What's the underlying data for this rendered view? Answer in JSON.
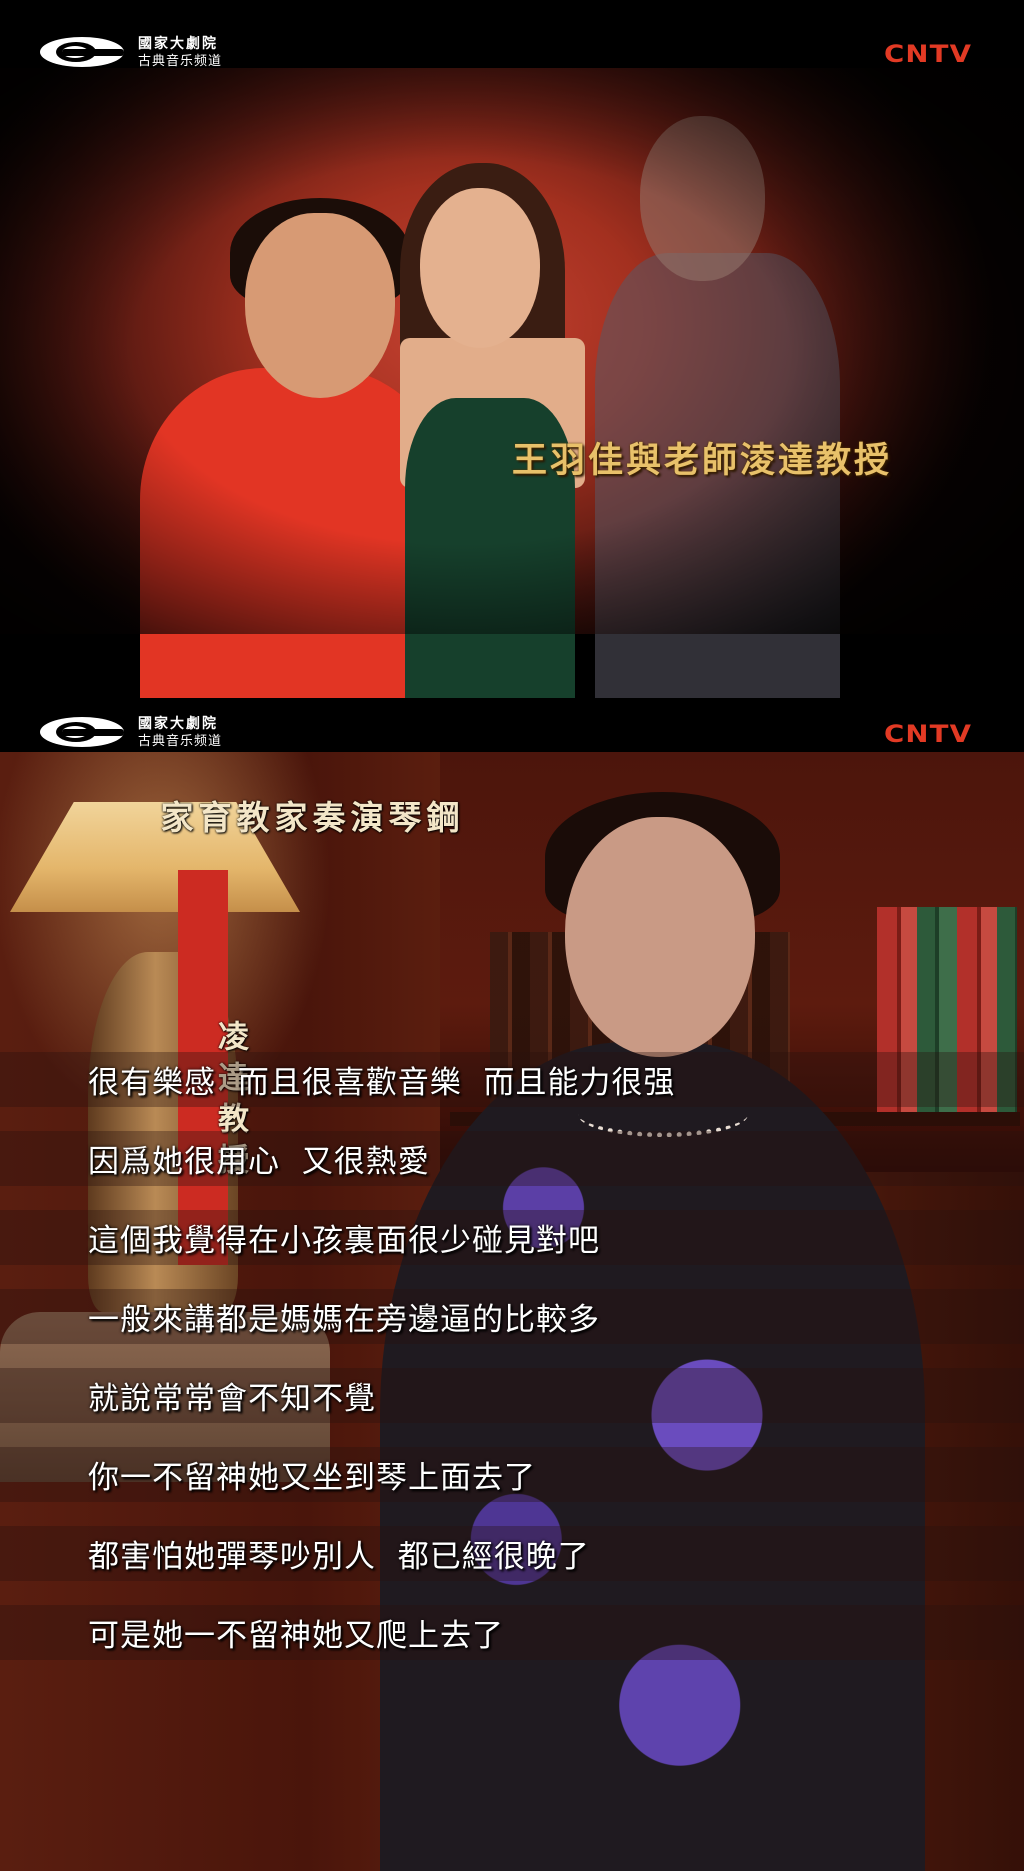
{
  "top_frame": {
    "logo": {
      "line1": "國家大劇院",
      "line2": "古典音乐频道"
    },
    "channel": "CNTV",
    "caption": "王羽佳與老師淩達教授"
  },
  "bottom_frame": {
    "logo": {
      "line1": "國家大劇院",
      "line2": "古典音乐频道"
    },
    "channel": "CNTV",
    "speaker_title": {
      "role": [
        "鋼",
        "琴",
        "演",
        "奏",
        "家",
        "教",
        "育",
        "家"
      ],
      "name": "凌達教授"
    },
    "subtitles": [
      "很有樂感  而且很喜歡音樂  而且能力很强",
      "因爲她很用心  又很熱愛",
      "這個我覺得在小孩裏面很少碰見對吧",
      "一般來講都是媽媽在旁邊逼的比較多",
      "就說常常會不知不覺",
      "你一不留神她又坐到琴上面去了",
      "都害怕她彈琴吵別人  都已經很晚了",
      "可是她一不留神她又爬上去了"
    ]
  }
}
